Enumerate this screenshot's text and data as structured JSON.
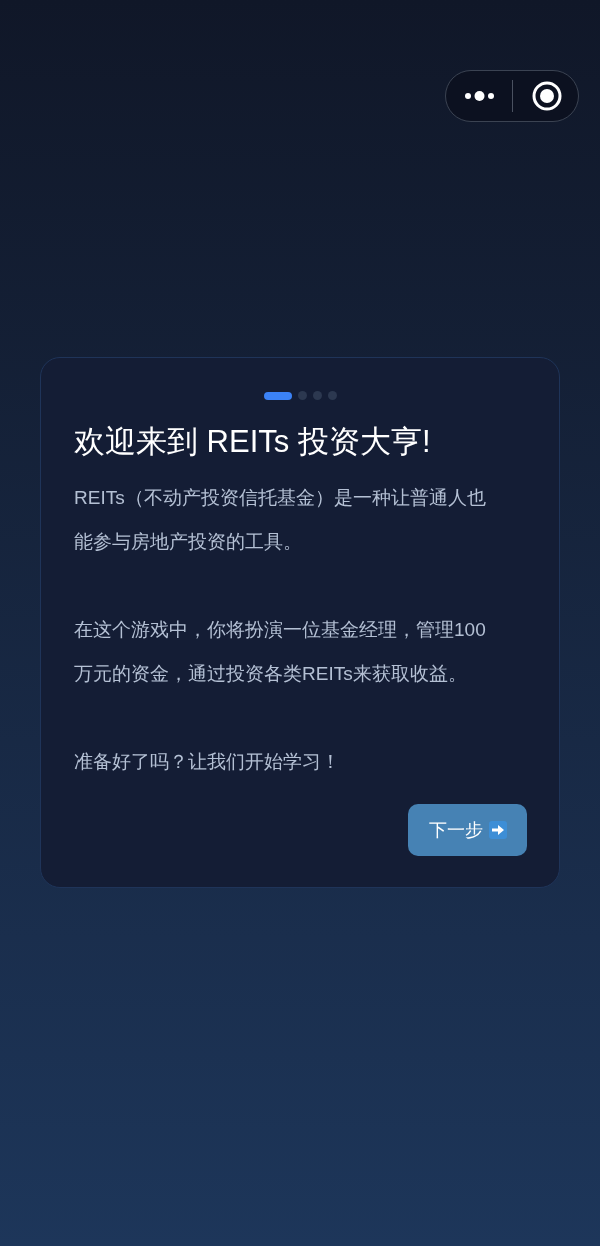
{
  "steps": [
    {
      "selected": true
    },
    {
      "selected": false
    },
    {
      "selected": false
    },
    {
      "selected": false
    }
  ],
  "title": "欢迎来到 REITs 投资大亨!",
  "paragraphs": [
    "REITs（不动产投资信托基金）是一种让普通人也能参与房地产投资的工具。",
    "在这个游戏中，你将扮演一位基金经理，管理100万元的资金，通过投资各类REITs来获取收益。",
    "准备好了吗？让我们开始学习！"
  ],
  "next_button": {
    "label": "下一步"
  }
}
